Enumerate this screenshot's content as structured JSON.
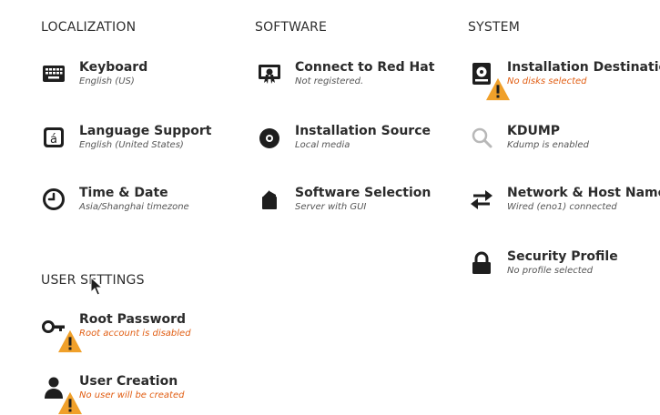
{
  "sections": {
    "localization": "LOCALIZATION",
    "software": "SOFTWARE",
    "system": "SYSTEM",
    "user_settings": "USER SETTINGS"
  },
  "spokes": {
    "keyboard": {
      "title": "Keyboard",
      "status": "English (US)",
      "icon": "keyboard-icon"
    },
    "language": {
      "title": "Language Support",
      "status": "English (United States)",
      "icon": "language-icon"
    },
    "time": {
      "title": "Time & Date",
      "status": "Asia/Shanghai timezone",
      "icon": "clock-icon"
    },
    "connect": {
      "title": "Connect to Red Hat",
      "status": "Not registered.",
      "icon": "redhat-certificate-icon"
    },
    "source": {
      "title": "Installation Source",
      "status": "Local media",
      "icon": "disc-icon"
    },
    "software": {
      "title": "Software Selection",
      "status": "Server with GUI",
      "icon": "package-icon"
    },
    "destination": {
      "title": "Installation Destination",
      "status": "No disks selected",
      "icon": "harddisk-icon",
      "warning": true
    },
    "kdump": {
      "title": "KDUMP",
      "status": "Kdump is enabled",
      "icon": "magnifier-icon"
    },
    "network": {
      "title": "Network & Host Name",
      "status": "Wired (eno1) connected",
      "icon": "network-arrows-icon"
    },
    "security": {
      "title": "Security Profile",
      "status": "No profile selected",
      "icon": "lock-icon"
    },
    "root": {
      "title": "Root Password",
      "status": "Root account is disabled",
      "icon": "key-icon",
      "warning": true
    },
    "user": {
      "title": "User Creation",
      "status": "No user will be created",
      "icon": "user-icon",
      "warning": true
    }
  },
  "colors": {
    "warning": "#e15d12",
    "warning_badge": "#f0a02a",
    "icon": "#1e1e1e",
    "kdump_icon": "#b8b8b8"
  }
}
